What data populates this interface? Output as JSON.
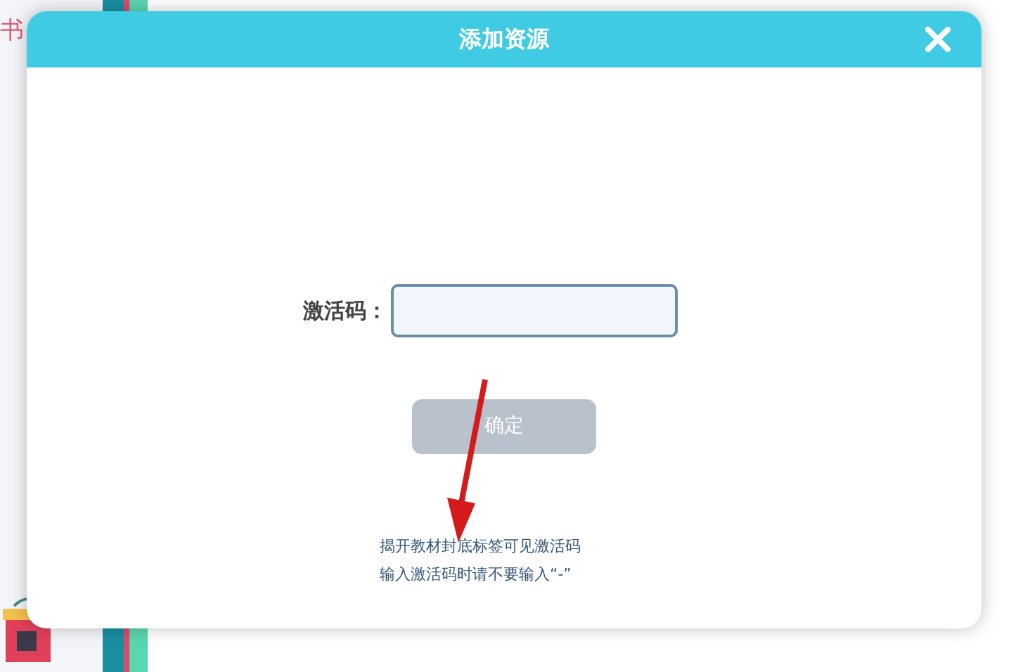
{
  "background": {
    "tab_label": "书"
  },
  "dialog": {
    "title": "添加资源",
    "field": {
      "label": "激活码："
    },
    "confirm_button": {
      "label": "确定",
      "disabled": true
    },
    "hints": [
      "揭开教材封底标签可见激活码",
      "输入激活码时请不要输入“-”"
    ]
  }
}
